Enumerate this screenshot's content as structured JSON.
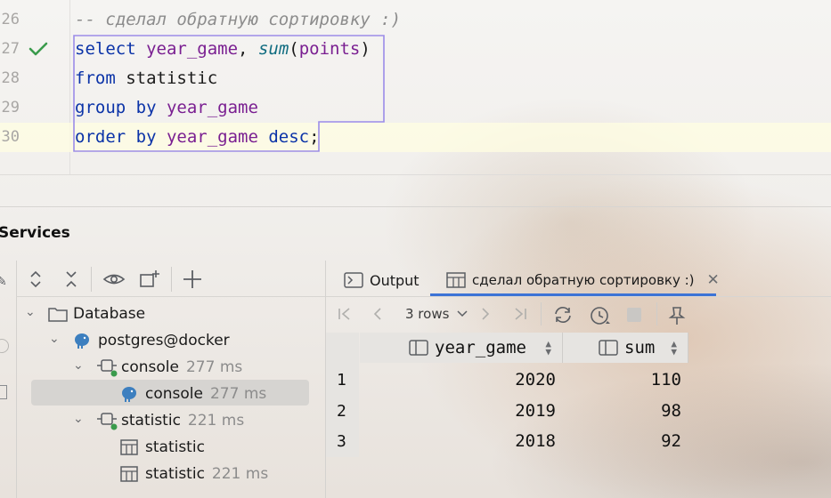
{
  "editor": {
    "line_numbers": [
      "26",
      "27",
      "28",
      "29",
      "30"
    ],
    "comment_line": "-- сделал обратную сортировку :)",
    "l27": {
      "kw": "select",
      "id1": "year_game",
      "sep": ", ",
      "fn": "sum",
      "open": "(",
      "id2": "points",
      "close": ")"
    },
    "l28": {
      "kw": "from",
      "rest": " statistic"
    },
    "l29": {
      "kw": "group by",
      "sp": " ",
      "id": "year_game"
    },
    "l30": {
      "kw": "order by",
      "sp": " ",
      "id": "year_game",
      "kw2": " desc",
      "end": ";"
    }
  },
  "services": {
    "title": "Services"
  },
  "tree": {
    "database_label": "Database",
    "postgres_label": "postgres@docker",
    "console_parent_label": "console",
    "console_parent_time": "277 ms",
    "console_child_label": "console",
    "console_child_time": "277 ms",
    "statistic_parent_label": "statistic",
    "statistic_parent_time": "221 ms",
    "statistic_table_label": "statistic",
    "statistic_result_label": "statistic",
    "statistic_result_time": "221 ms"
  },
  "tabs": {
    "output_label": "Output",
    "result_label": "сделал обратную сортировку :)"
  },
  "grid": {
    "rows_label": "3 rows",
    "columns": [
      "year_game",
      "sum"
    ],
    "rows": [
      {
        "num": "1",
        "year_game": "2020",
        "sum": "110"
      },
      {
        "num": "2",
        "year_game": "2019",
        "sum": "98"
      },
      {
        "num": "3",
        "year_game": "2018",
        "sum": "92"
      }
    ]
  },
  "colors": {
    "keyword": "#0b33a8",
    "identifier": "#7a1f91",
    "function": "#0f6c80",
    "active_tab_underline": "#3c73d6",
    "success_check": "#3a9b4c"
  }
}
